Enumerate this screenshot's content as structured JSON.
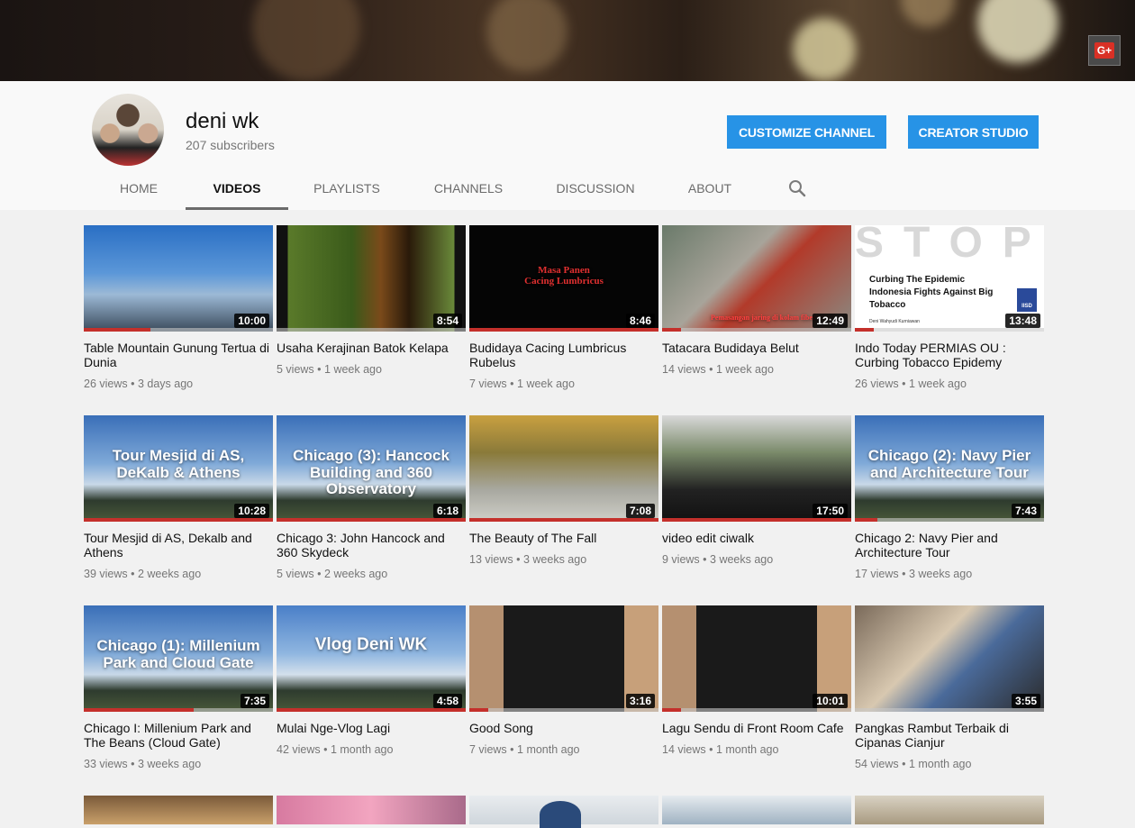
{
  "channel": {
    "name": "deni wk",
    "subscribers": "207 subscribers",
    "customize_label": "CUSTOMIZE CHANNEL",
    "studio_label": "CREATOR STUDIO",
    "gplus_label": "G+"
  },
  "tabs": [
    {
      "label": "HOME",
      "active": false
    },
    {
      "label": "VIDEOS",
      "active": true
    },
    {
      "label": "PLAYLISTS",
      "active": false
    },
    {
      "label": "CHANNELS",
      "active": false
    },
    {
      "label": "DISCUSSION",
      "active": false
    },
    {
      "label": "ABOUT",
      "active": false
    }
  ],
  "colors": {
    "accent": "#2793e6",
    "progress": "#c4302b"
  },
  "videos": [
    {
      "title": "Table Mountain Gunung Tertua di Dunia",
      "views": "26 views",
      "age": "3 days ago",
      "duration": "10:00",
      "progress": 0.35
    },
    {
      "title": "Usaha Kerajinan Batok Kelapa",
      "views": "5 views",
      "age": "1 week ago",
      "duration": "8:54",
      "progress": 0
    },
    {
      "title": "Budidaya Cacing Lumbricus Rubelus",
      "views": "7 views",
      "age": "1 week ago",
      "duration": "8:46",
      "progress": 1,
      "thumb_text": "Masa Panen Cacing Lumbricus"
    },
    {
      "title": "Tatacara Budidaya Belut",
      "views": "14 views",
      "age": "1 week ago",
      "duration": "12:49",
      "progress": 0.1,
      "thumb_text": "Pemasangan jaring di kolam fiber"
    },
    {
      "title": "Indo Today PERMIAS OU : Curbing Tobacco Epidemy",
      "views": "26 views",
      "age": "1 week ago",
      "duration": "13:48",
      "progress": 0.1,
      "thumb_text": "STOP",
      "thumb_sub": "Curbing The Epidemic Indonesia Fights Against Big Tobacco",
      "thumb_author": "Deni Wahyudi Kurniawan",
      "thumb_logo": "IISD"
    },
    {
      "title": "Tour Mesjid di AS, Dekalb and Athens",
      "views": "39 views",
      "age": "2 weeks ago",
      "duration": "10:28",
      "progress": 1,
      "thumb_text": "Tour Mesjid di AS, DeKalb & Athens"
    },
    {
      "title": "Chicago 3: John Hancock and 360 Skydeck",
      "views": "5 views",
      "age": "2 weeks ago",
      "duration": "6:18",
      "progress": 1,
      "thumb_text": "Chicago (3): Hancock Building and 360 Observatory"
    },
    {
      "title": "The Beauty of The Fall",
      "views": "13 views",
      "age": "3 weeks ago",
      "duration": "7:08",
      "progress": 1
    },
    {
      "title": "video edit ciwalk",
      "views": "9 views",
      "age": "3 weeks ago",
      "duration": "17:50",
      "progress": 1
    },
    {
      "title": "Chicago 2: Navy Pier and Architecture Tour",
      "views": "17 views",
      "age": "3 weeks ago",
      "duration": "7:43",
      "progress": 0.12,
      "thumb_text": "Chicago (2): Navy Pier and Architecture Tour"
    },
    {
      "title": "Chicago I: Millenium Park and The Beans (Cloud Gate)",
      "views": "33 views",
      "age": "3 weeks ago",
      "duration": "7:35",
      "progress": 0.58,
      "thumb_text": "Chicago (1): Millenium Park and Cloud Gate"
    },
    {
      "title": "Mulai Nge-Vlog Lagi",
      "views": "42 views",
      "age": "1 month ago",
      "duration": "4:58",
      "progress": 1,
      "thumb_text": "Vlog Deni WK"
    },
    {
      "title": "Good Song",
      "views": "7 views",
      "age": "1 month ago",
      "duration": "3:16",
      "progress": 0.1
    },
    {
      "title": "Lagu Sendu di Front Room Cafe",
      "views": "14 views",
      "age": "1 month ago",
      "duration": "10:01",
      "progress": 0.1
    },
    {
      "title": "Pangkas Rambut Terbaik di Cipanas Cianjur",
      "views": "54 views",
      "age": "1 month ago",
      "duration": "3:55",
      "progress": 0
    }
  ]
}
